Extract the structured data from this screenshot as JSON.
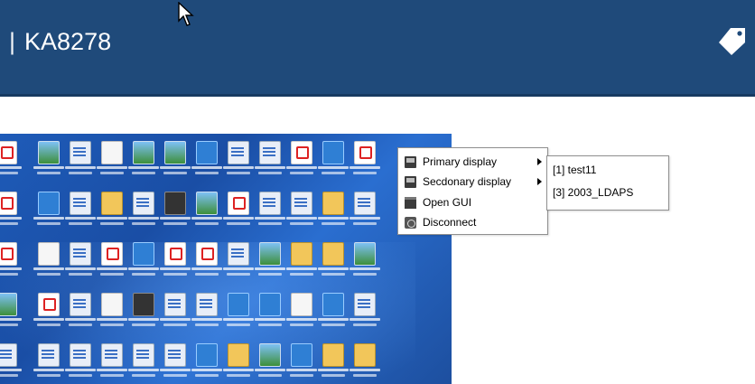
{
  "header": {
    "separator": "|",
    "title": "KA8278",
    "tag_icon": "tag-icon",
    "background": "#1f4a7a"
  },
  "context_menu": {
    "items": [
      {
        "label": "Primary display",
        "icon": "monitor-icon",
        "has_submenu": true
      },
      {
        "label": "Secdonary display",
        "icon": "monitor-icon",
        "has_submenu": true
      },
      {
        "label": "Open GUI",
        "icon": "window-icon",
        "has_submenu": false
      },
      {
        "label": "Disconnect",
        "icon": "disconnect-icon",
        "has_submenu": false
      }
    ]
  },
  "submenu": {
    "items": [
      {
        "label": "[1] test11"
      },
      {
        "label": "[3] 2003_LDAPS"
      }
    ]
  }
}
